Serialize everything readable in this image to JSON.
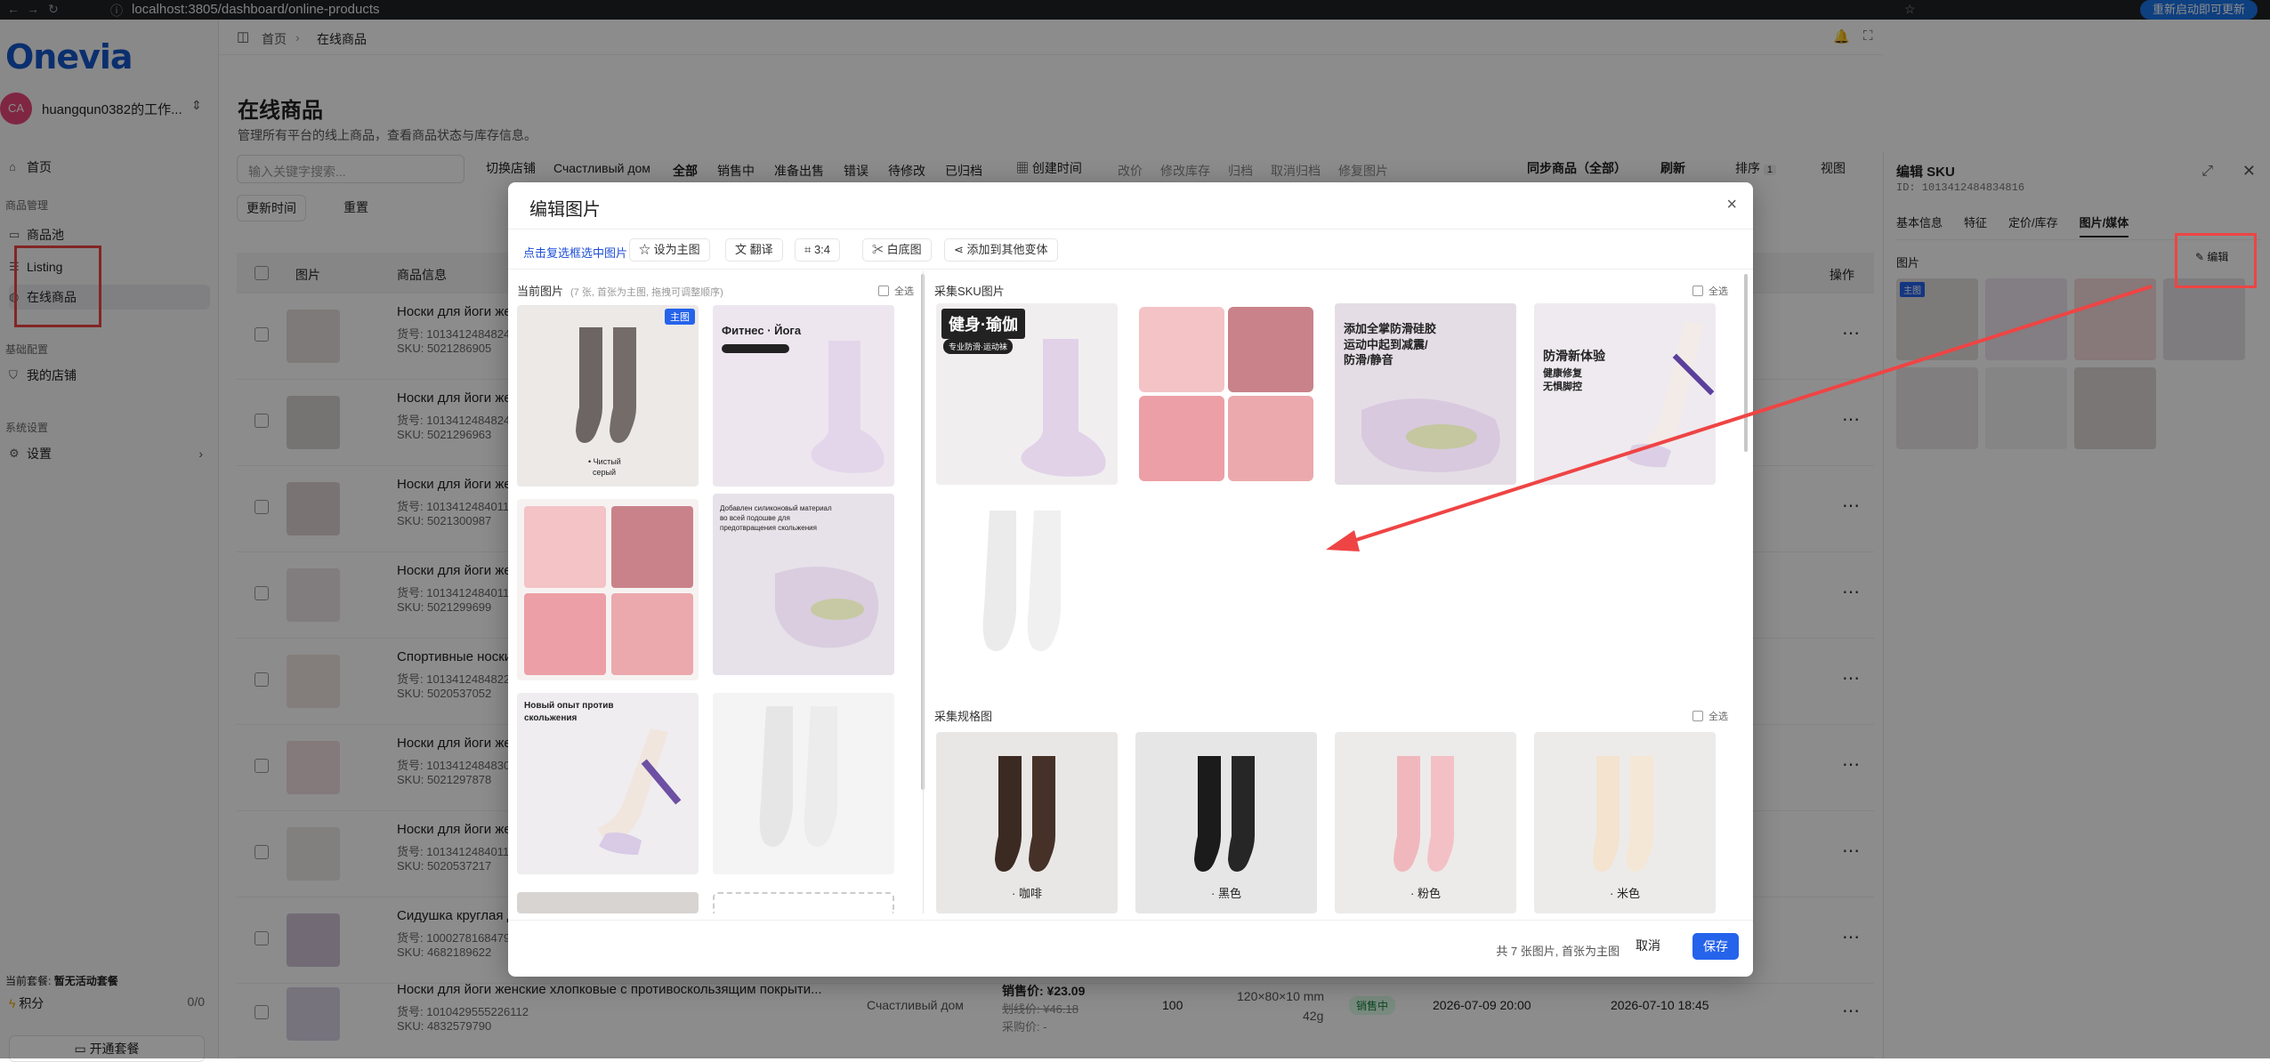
{
  "browser": {
    "url": "localhost:3805/dashboard/online-products",
    "update_label": "重新启动即可更新"
  },
  "sidebar": {
    "logo": "Onevia",
    "workspace": "huangqun0382的工作...",
    "avatar": "CA",
    "home": "首页",
    "section_products": "商品管理",
    "product_pool": "商品池",
    "listing": "Listing",
    "online_products": "在线商品",
    "section_basic": "基础配置",
    "my_stores": "我的店铺",
    "section_system": "系统设置",
    "settings": "设置",
    "plan_label": "当前套餐:",
    "plan_value": "暂无活动套餐",
    "points_label": "积分",
    "points_value": "0/0",
    "open_plan": "开通套餐"
  },
  "header": {
    "breadcrumb_home": "首页",
    "breadcrumb_sep": "›",
    "breadcrumb_current": "在线商品"
  },
  "page": {
    "title": "在线商品",
    "subtitle": "管理所有平台的线上商品，查看商品状态与库存信息。",
    "search_placeholder": "输入关键字搜索...",
    "switch_store": "切换店铺",
    "store_name": "Счастливый дом",
    "status_tabs": [
      "全部",
      "销售中",
      "准备出售",
      "错误",
      "待修改",
      "已归档"
    ],
    "create_time": "创建时间",
    "actions": [
      "改价",
      "修改库存",
      "归档",
      "取消归档",
      "修复图片"
    ],
    "sync": "同步商品（全部）",
    "refresh": "刷新",
    "sort": "排序",
    "sort_count": "1",
    "view": "视图",
    "update_time": "更新时间",
    "reset": "重置",
    "col_image": "图片",
    "col_info": "商品信息",
    "col_actions": "操作"
  },
  "rows": [
    {
      "title": "Носки для йоги жен",
      "sku_no": "货号: 1013412484824",
      "sku": "SKU: 5021286905"
    },
    {
      "title": "Носки для йоги жен",
      "sku_no": "货号: 1013412484824",
      "sku": "SKU: 5021296963"
    },
    {
      "title": "Носки для йоги жен",
      "sku_no": "货号: 1013412484011",
      "sku": "SKU: 5021300987"
    },
    {
      "title": "Носки для йоги жен",
      "sku_no": "货号: 1013412484011",
      "sku": "SKU: 5021299699"
    },
    {
      "title": "Спортивные носки д",
      "sku_no": "货号: 1013412484822",
      "sku": "SKU: 5020537052"
    },
    {
      "title": "Носки для йоги жен",
      "sku_no": "货号: 1013412484830",
      "sku": "SKU: 5021297878"
    },
    {
      "title": "Носки для йоги жен",
      "sku_no": "货号: 1013412484011",
      "sku": "SKU: 5020537217"
    },
    {
      "title": "Сидушка круглая до",
      "sku_no": "货号: 1000278168479",
      "sku": "SKU: 4682189622"
    }
  ],
  "last_row": {
    "title": "Носки для йоги женские хлопковые с противоскользящим покрыти...",
    "sku_no": "货号: 1010429555226112",
    "sku": "SKU: 4832579790",
    "store": "Счастливый дом",
    "price": "销售价: ¥23.09",
    "old_price": "划线价: ¥46.18",
    "purchase": "采购价: -",
    "stock": "100",
    "size": "120×80×10 mm",
    "weight": "42g",
    "status": "销售中",
    "created": "2026-07-09 20:00",
    "updated": "2026-07-10 18:45"
  },
  "rpanel": {
    "title": "编辑 SKU",
    "id": "ID: 1013412484834816",
    "tabs": [
      "基本信息",
      "特征",
      "定价/库存",
      "图片/媒体"
    ],
    "images_label": "图片",
    "edit": "编辑",
    "main_tag": "主图"
  },
  "modal": {
    "title": "编辑图片",
    "close": "×",
    "tip": "点击复选框选中图片",
    "tools": [
      "设为主图",
      "翻译",
      "3:4",
      "白底图",
      "添加到其他变体"
    ],
    "current_title": "当前图片",
    "current_hint": "(7 张, 首张为主图, 拖拽可调整顺序)",
    "select_all": "全选",
    "main_tag": "主图",
    "sku_title": "采集SKU图片",
    "spec_title": "采集规格图",
    "spec_labels": [
      "· 咖啡",
      "· 黑色",
      "· 粉色",
      "· 米色"
    ],
    "img_texts": {
      "fitness": "Фитнес · Йога",
      "yoga": "健身·瑜伽",
      "yoga_sub": "专业防滑·运动袜",
      "anti": "添加全掌防滑硅胶\n运动中起到减震/\n防滑/静音",
      "new_exp": "防滑新体验",
      "new_sub": "健康修复\n无惧脚控",
      "ru_new": "Новый опыт против\nскольжения",
      "ru_desc": "Добавлен силиконовый материал\nво всей подошве для\nпредотвращения скольжения",
      "sock_note": "• Чистый\n  серый"
    },
    "footer_info": "共 7 张图片, 首张为主图",
    "cancel": "取消",
    "save": "保存"
  },
  "colors": {
    "accent": "#2563eb",
    "annotation": "#ef4444",
    "logo": "#1456c8"
  }
}
